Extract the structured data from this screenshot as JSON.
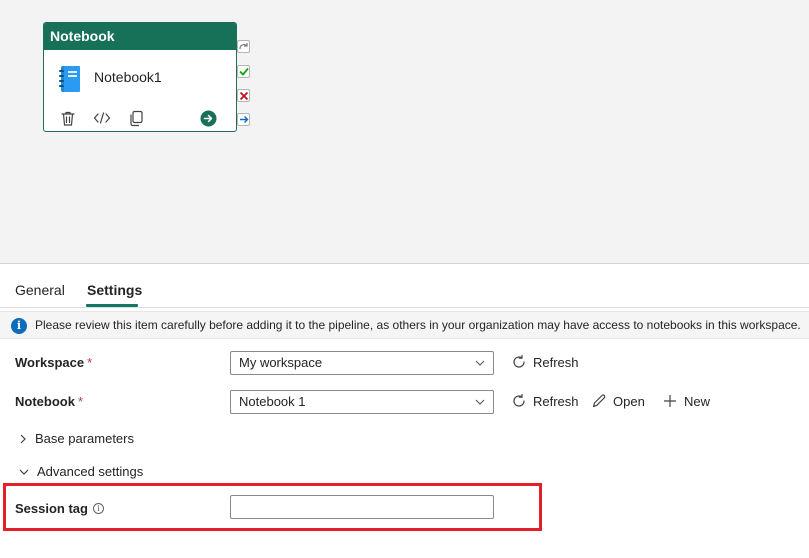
{
  "activity": {
    "header": "Notebook",
    "name": "Notebook1",
    "icons": [
      "notebook-icon",
      "trash-icon",
      "code-icon",
      "copy-icon",
      "go-arrow-icon"
    ],
    "handles": [
      "skip-icon",
      "success-check-icon",
      "failure-x-icon",
      "completion-arrow-icon"
    ]
  },
  "tabs": [
    {
      "label": "General",
      "active": false
    },
    {
      "label": "Settings",
      "active": true
    }
  ],
  "info": {
    "icon": "info-icon",
    "text": "Please review this item carefully before adding it to the pipeline, as others in your organization may have access to notebooks in this workspace."
  },
  "workspace": {
    "label": "Workspace",
    "required": "*",
    "value": "My workspace",
    "refresh_label": "Refresh"
  },
  "notebook": {
    "label": "Notebook",
    "required": "*",
    "value": "Notebook 1",
    "refresh_label": "Refresh",
    "open_label": "Open",
    "new_label": "New"
  },
  "base_parameters": {
    "label": "Base parameters",
    "expanded": false
  },
  "advanced_settings": {
    "label": "Advanced settings",
    "expanded": true
  },
  "session_tag": {
    "label": "Session tag",
    "value": "",
    "placeholder": ""
  },
  "colors": {
    "header_green": "#177058",
    "accent_teal": "#117865",
    "info_blue": "#0f6cbd",
    "required_red": "#c4314b",
    "highlight_red": "#e0202a"
  }
}
